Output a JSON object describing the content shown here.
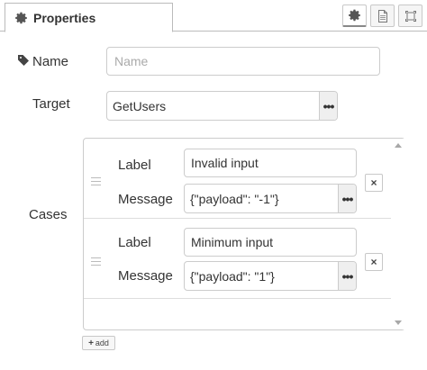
{
  "tab": {
    "title": "Properties",
    "icon": "gear-icon"
  },
  "toolbar": {
    "buttons": [
      {
        "name": "settings",
        "icon": "gear-icon"
      },
      {
        "name": "description",
        "icon": "document-icon"
      },
      {
        "name": "appearance",
        "icon": "frame-icon"
      }
    ]
  },
  "form": {
    "name_label": "Name",
    "name_placeholder": "Name",
    "name_value": "",
    "target_label": "Target",
    "target_value": "GetUsers",
    "cases_label": "Cases"
  },
  "cases": [
    {
      "label_caption": "Label",
      "label_value": "Invalid input",
      "message_caption": "Message",
      "message_value": "{\"payload\": \"-1\"}"
    },
    {
      "label_caption": "Label",
      "label_value": "Minimum input",
      "message_caption": "Message",
      "message_value": "{\"payload\": \"1\"}"
    }
  ],
  "more_button_text": "•••",
  "remove_button_text": "×",
  "add_button": {
    "plus": "+",
    "label": "add"
  },
  "colors": {
    "border": "#cccccc",
    "text": "#333333",
    "placeholder": "#aaaaaa"
  }
}
